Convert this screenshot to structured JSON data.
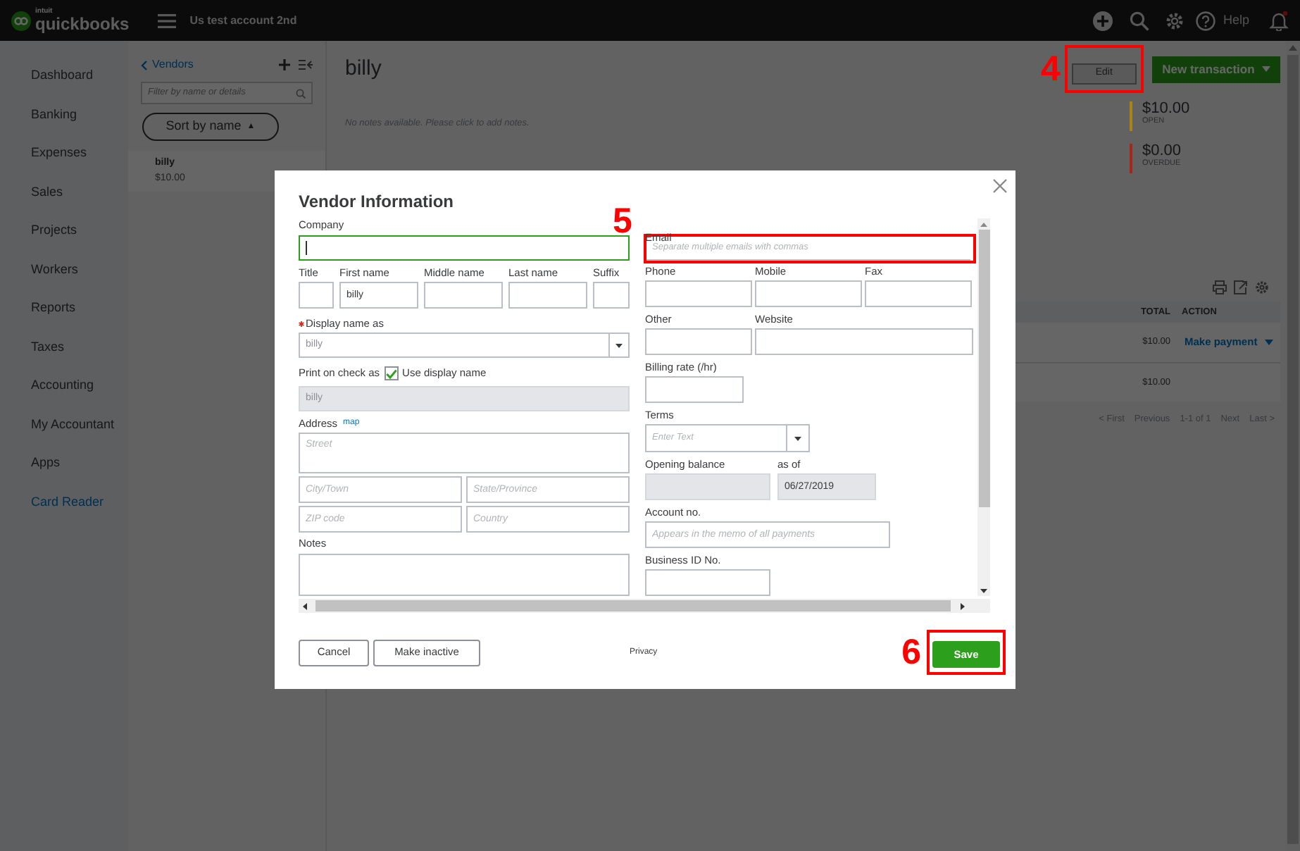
{
  "top_bar": {
    "brand_small": "intuit",
    "brand": "quickbooks",
    "account": "Us test account 2nd",
    "help": "Help"
  },
  "nav": [
    {
      "label": "Dashboard",
      "kind": "item"
    },
    {
      "label": "Banking",
      "kind": "item"
    },
    {
      "label": "Expenses",
      "kind": "item"
    },
    {
      "label": "Sales",
      "kind": "item"
    },
    {
      "label": "Projects",
      "kind": "item"
    },
    {
      "label": "Workers",
      "kind": "item"
    },
    {
      "label": "Reports",
      "kind": "item"
    },
    {
      "label": "Taxes",
      "kind": "item"
    },
    {
      "label": "Accounting",
      "kind": "item"
    },
    {
      "label": "My Accountant",
      "kind": "item"
    },
    {
      "label": "Apps",
      "kind": "item"
    },
    {
      "label": "Card Reader",
      "kind": "link"
    }
  ],
  "vendor_list": {
    "back": "Vendors",
    "filter_placeholder": "Filter by name or details",
    "sort": "Sort by name",
    "sort_arrow": "▲",
    "items": [
      {
        "name": "billy",
        "amount": "$10.00",
        "selected": true
      }
    ]
  },
  "vendor": {
    "name": "billy",
    "notes": "No notes available. Please click to add notes.",
    "edit": "Edit",
    "new_transaction": "New transaction",
    "summary": [
      {
        "amount": "$10.00",
        "label": "OPEN",
        "color": "#a8841c"
      },
      {
        "amount": "$0.00",
        "label": "OVERDUE",
        "color": "#a3281a"
      }
    ]
  },
  "table": {
    "columns": [
      "TOTAL",
      "ACTION"
    ],
    "rows": [
      {
        "total": "$10.00",
        "action": "Make payment"
      }
    ],
    "footer_total": "$10.00",
    "pagination": [
      "< First",
      "Previous",
      "1-1 of 1",
      "Next",
      "Last >"
    ]
  },
  "modal": {
    "title": "Vendor Information",
    "company": {
      "label": "Company"
    },
    "name_fields": [
      {
        "label": "Title"
      },
      {
        "label": "First name",
        "value": "billy"
      },
      {
        "label": "Middle name"
      },
      {
        "label": "Last name"
      },
      {
        "label": "Suffix"
      }
    ],
    "display_name": {
      "label": "Display name as",
      "required": true,
      "value": "billy"
    },
    "print_on_check": {
      "label": "Print on check as",
      "checkbox_label": "Use display name",
      "checked": true,
      "value": "billy"
    },
    "address": {
      "label": "Address",
      "link": "map",
      "fields": [
        {
          "placeholder": "Street"
        },
        {
          "placeholder": "City/Town"
        },
        {
          "placeholder": "State/Province"
        },
        {
          "placeholder": "ZIP code"
        },
        {
          "placeholder": "Country"
        }
      ]
    },
    "notes": {
      "label": "Notes"
    },
    "email": {
      "label": "Email",
      "placeholder": "Separate multiple emails with commas"
    },
    "phones": [
      {
        "label": "Phone"
      },
      {
        "label": "Mobile"
      },
      {
        "label": "Fax"
      }
    ],
    "other": {
      "label": "Other"
    },
    "website": {
      "label": "Website"
    },
    "billing_rate": {
      "label": "Billing rate (/hr)"
    },
    "terms": {
      "label": "Terms",
      "placeholder": "Enter Text"
    },
    "opening_balance": {
      "label": "Opening balance"
    },
    "as_of": {
      "label": "as of",
      "value": "06/27/2019"
    },
    "account_no": {
      "label": "Account no.",
      "placeholder": "Appears in the memo of all payments"
    },
    "business_id": {
      "label": "Business ID No."
    },
    "cancel": "Cancel",
    "make_inactive": "Make inactive",
    "privacy": "Privacy",
    "save": "Save"
  },
  "annotations": [
    {
      "label": "4"
    },
    {
      "label": "5"
    },
    {
      "label": "6"
    }
  ]
}
